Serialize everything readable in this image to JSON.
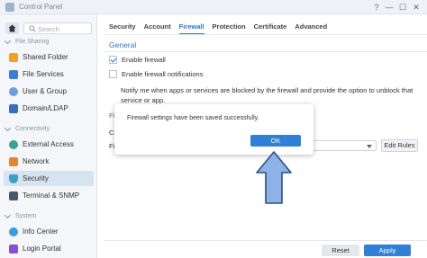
{
  "window": {
    "title": "Control Panel",
    "help_glyph": "?",
    "minimize_glyph": "—",
    "maximize_glyph": "☐",
    "close_glyph": "✕"
  },
  "sidebar": {
    "search_placeholder": "Search",
    "sections": [
      {
        "label": "File Sharing",
        "items": [
          {
            "label": "Shared Folder",
            "icon": "folder-icon",
            "color": "#f0a030"
          },
          {
            "label": "File Services",
            "icon": "file-services-icon",
            "color": "#3a7fd0"
          },
          {
            "label": "User & Group",
            "icon": "user-group-icon",
            "color": "#6aa0d8"
          },
          {
            "label": "Domain/LDAP",
            "icon": "domain-icon",
            "color": "#3a6fb8"
          }
        ]
      },
      {
        "label": "Connectivity",
        "items": [
          {
            "label": "External Access",
            "icon": "globe-icon",
            "color": "#36a38f"
          },
          {
            "label": "Network",
            "icon": "network-icon",
            "color": "#e0862f"
          },
          {
            "label": "Security",
            "icon": "shield-icon",
            "color": "#3aa0c8",
            "active": true
          },
          {
            "label": "Terminal & SNMP",
            "icon": "terminal-icon",
            "color": "#4a5866"
          }
        ]
      },
      {
        "label": "System",
        "items": [
          {
            "label": "Info Center",
            "icon": "info-icon",
            "color": "#3a9fd8"
          },
          {
            "label": "Login Portal",
            "icon": "login-portal-icon",
            "color": "#8a4fd0"
          }
        ]
      }
    ]
  },
  "tabs": [
    "Security",
    "Account",
    "Firewall",
    "Protection",
    "Certificate",
    "Advanced"
  ],
  "active_tab": "Firewall",
  "main": {
    "group_title": "General",
    "enable_firewall": {
      "label": "Enable firewall",
      "checked": true
    },
    "enable_notifications": {
      "label": "Enable firewall notifications",
      "checked": false
    },
    "notify_text": "Notify me when apps or services are blocked by the firewall and provide the option to unblock that service or app.",
    "partial_section": "Fi",
    "partial_cu": "Cu",
    "partial_fi": "Fi",
    "edit_rules_label": "Edit Rules"
  },
  "footer": {
    "reset_label": "Reset",
    "apply_label": "Apply"
  },
  "dialog": {
    "message": "Firewall settings have been saved successfully.",
    "ok_label": "OK"
  }
}
